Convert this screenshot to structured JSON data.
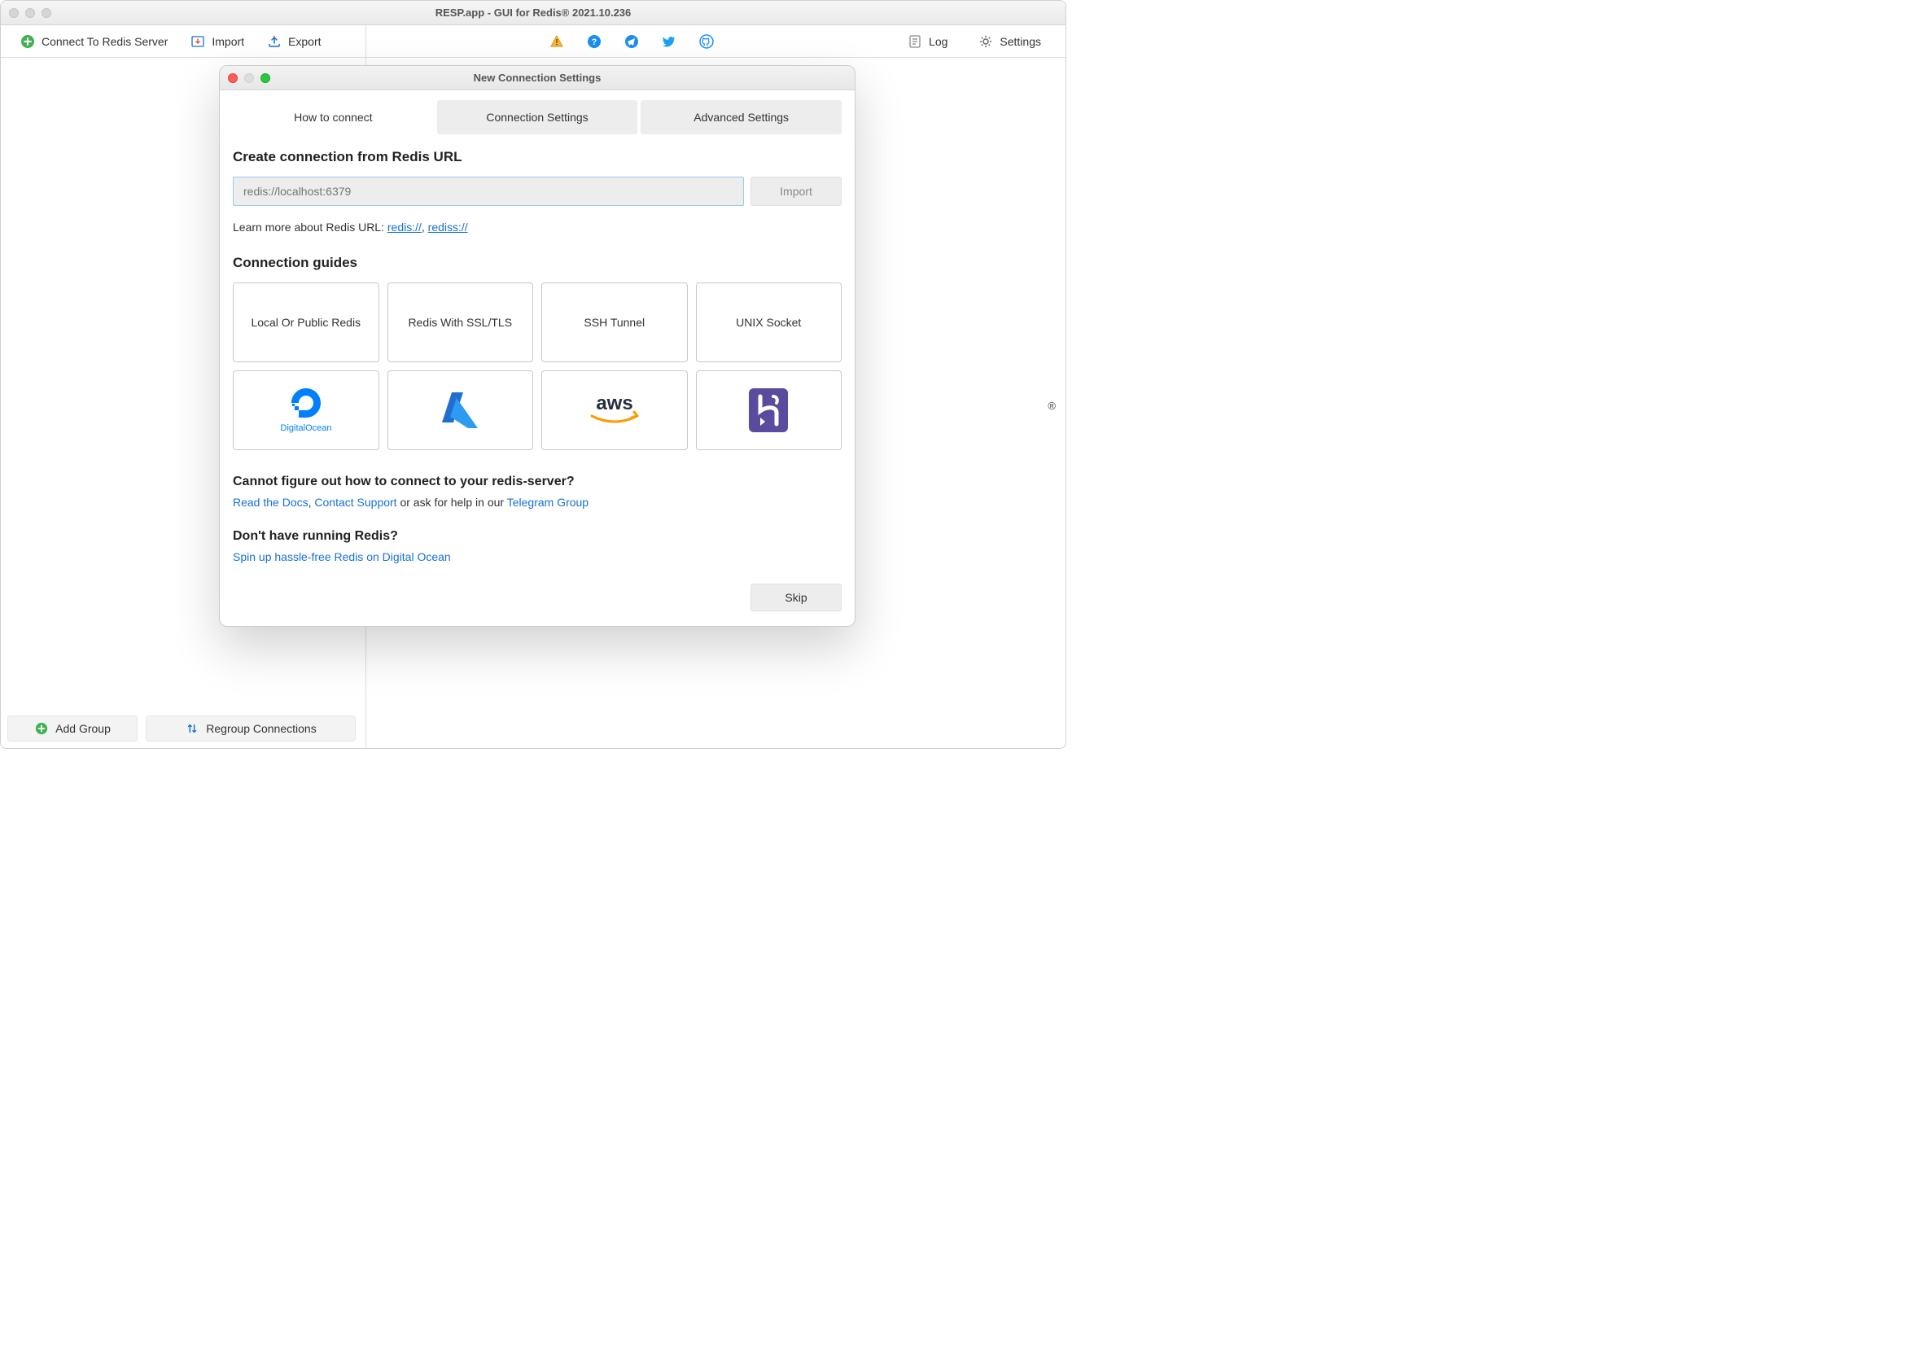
{
  "window": {
    "title": "RESP.app - GUI for Redis® 2021.10.236"
  },
  "toolbar": {
    "connect": "Connect To Redis Server",
    "import": "Import",
    "export": "Export",
    "log": "Log",
    "settings": "Settings"
  },
  "sidebar_bottom": {
    "add_group": "Add Group",
    "regroup": "Regroup Connections"
  },
  "trademark": "®",
  "dialog": {
    "title": "New Connection Settings",
    "tabs": {
      "how": "How to connect",
      "conn": "Connection Settings",
      "adv": "Advanced Settings"
    },
    "create_h": "Create connection from Redis URL",
    "url_placeholder": "redis://localhost:6379",
    "import_btn": "Import",
    "learn_pre": "Learn more about Redis URL: ",
    "learn_l1": "redis://",
    "learn_sep": ", ",
    "learn_l2": "rediss://",
    "guides_h": "Connection guides",
    "guides": {
      "local": "Local Or Public Redis",
      "ssl": "Redis With SSL/TLS",
      "ssh": "SSH Tunnel",
      "unix": "UNIX Socket"
    },
    "cannot_h": "Cannot figure out how to connect to your redis-server?",
    "cannot_docs": "Read the Docs",
    "cannot_sep1": ", ",
    "cannot_contact": "Contact Support",
    "cannot_mid": " or ask for help in our ",
    "cannot_tg": "Telegram Group",
    "nohave_h": "Don't have running Redis?",
    "nohave_link": "Spin up hassle-free Redis on Digital Ocean",
    "skip": "Skip"
  }
}
